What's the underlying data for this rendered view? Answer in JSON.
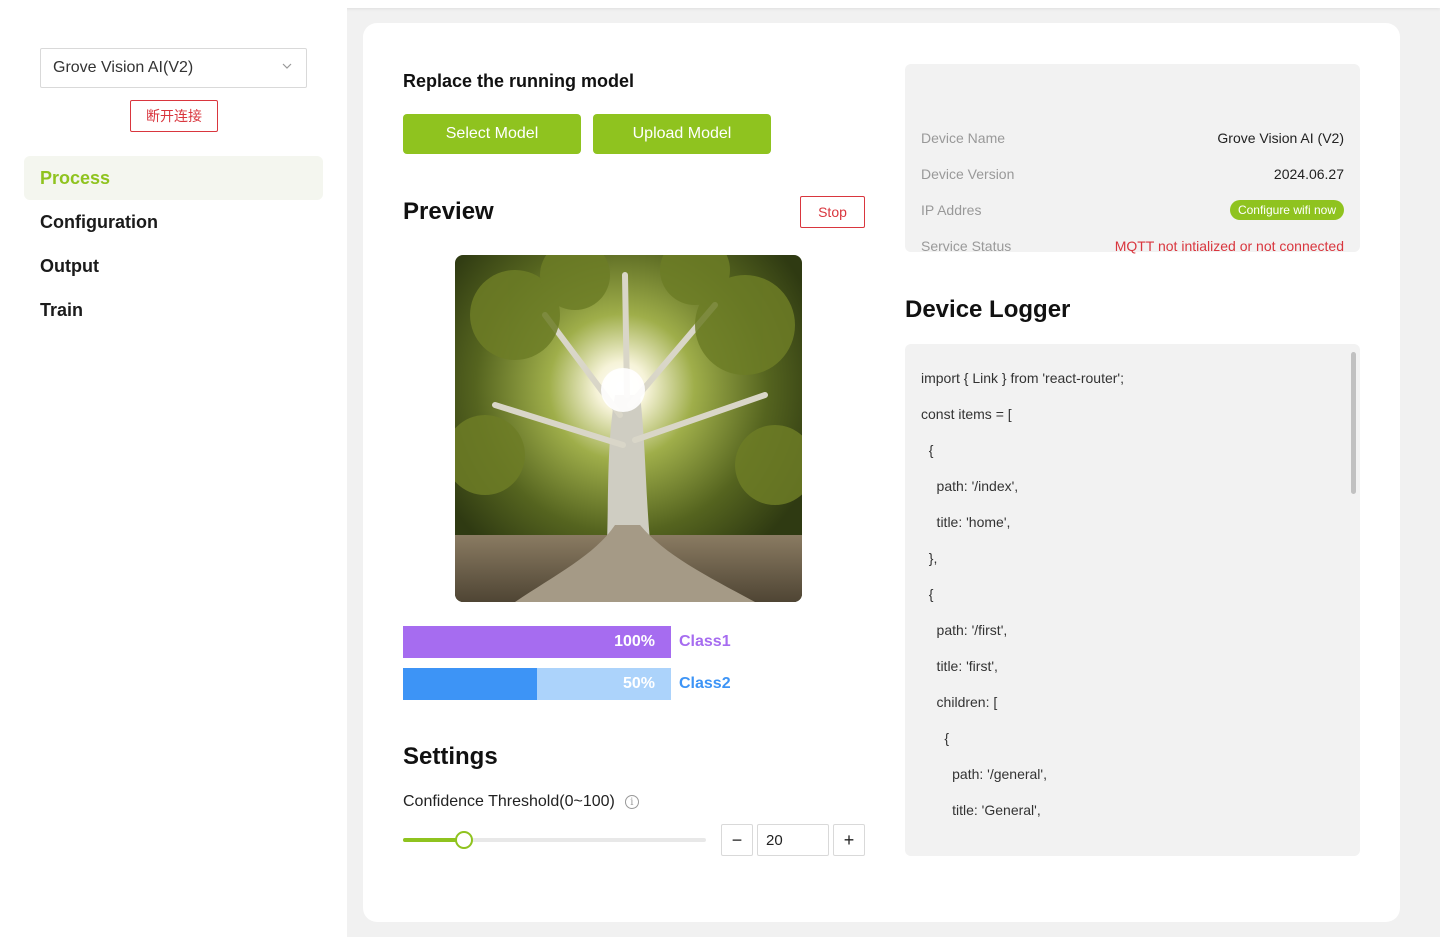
{
  "sidebar": {
    "device_select_value": "Grove Vision AI(V2)",
    "disconnect_label": "断开连接",
    "nav": [
      {
        "label": "Process",
        "active": true
      },
      {
        "label": "Configuration",
        "active": false
      },
      {
        "label": "Output",
        "active": false
      },
      {
        "label": "Train",
        "active": false
      }
    ]
  },
  "model": {
    "heading": "Replace the running model",
    "select_label": "Select Model",
    "upload_label": "Upload Model"
  },
  "preview": {
    "heading": "Preview",
    "stop_label": "Stop",
    "classes": [
      {
        "name": "Class1",
        "percent_text": "100%",
        "value": 1.0,
        "color": "#a66cf0",
        "track_color": "#a66cf0"
      },
      {
        "name": "Class2",
        "percent_text": "50%",
        "value": 0.5,
        "color": "#3d94f6",
        "track_color": "#acd3fb"
      }
    ]
  },
  "settings": {
    "heading": "Settings",
    "confidence_label": "Confidence Threshold(0~100)",
    "confidence_value": "20",
    "min": 0,
    "max": 100,
    "minus": "−",
    "plus": "+"
  },
  "device_info": {
    "rows": [
      {
        "key": "Device Name",
        "value": "Grove Vision AI (V2)"
      },
      {
        "key": "Device Version",
        "value": "2024.06.27"
      },
      {
        "key": "IP Addres",
        "value": "Configure wifi now"
      },
      {
        "key": "Service Status",
        "value": "MQTT not intialized or not connected"
      }
    ]
  },
  "logger": {
    "heading": "Device Logger",
    "lines": [
      "import { Link } from 'react-router';",
      "const items = [",
      "  {",
      "    path: '/index',",
      "    title: 'home',",
      "  },",
      "  {",
      "    path: '/first',",
      "    title: 'first',",
      "    children: [",
      "      {",
      "        path: '/general',",
      "        title: 'General',"
    ]
  },
  "colors": {
    "accent": "#8fc31f",
    "danger": "#d9363e"
  }
}
